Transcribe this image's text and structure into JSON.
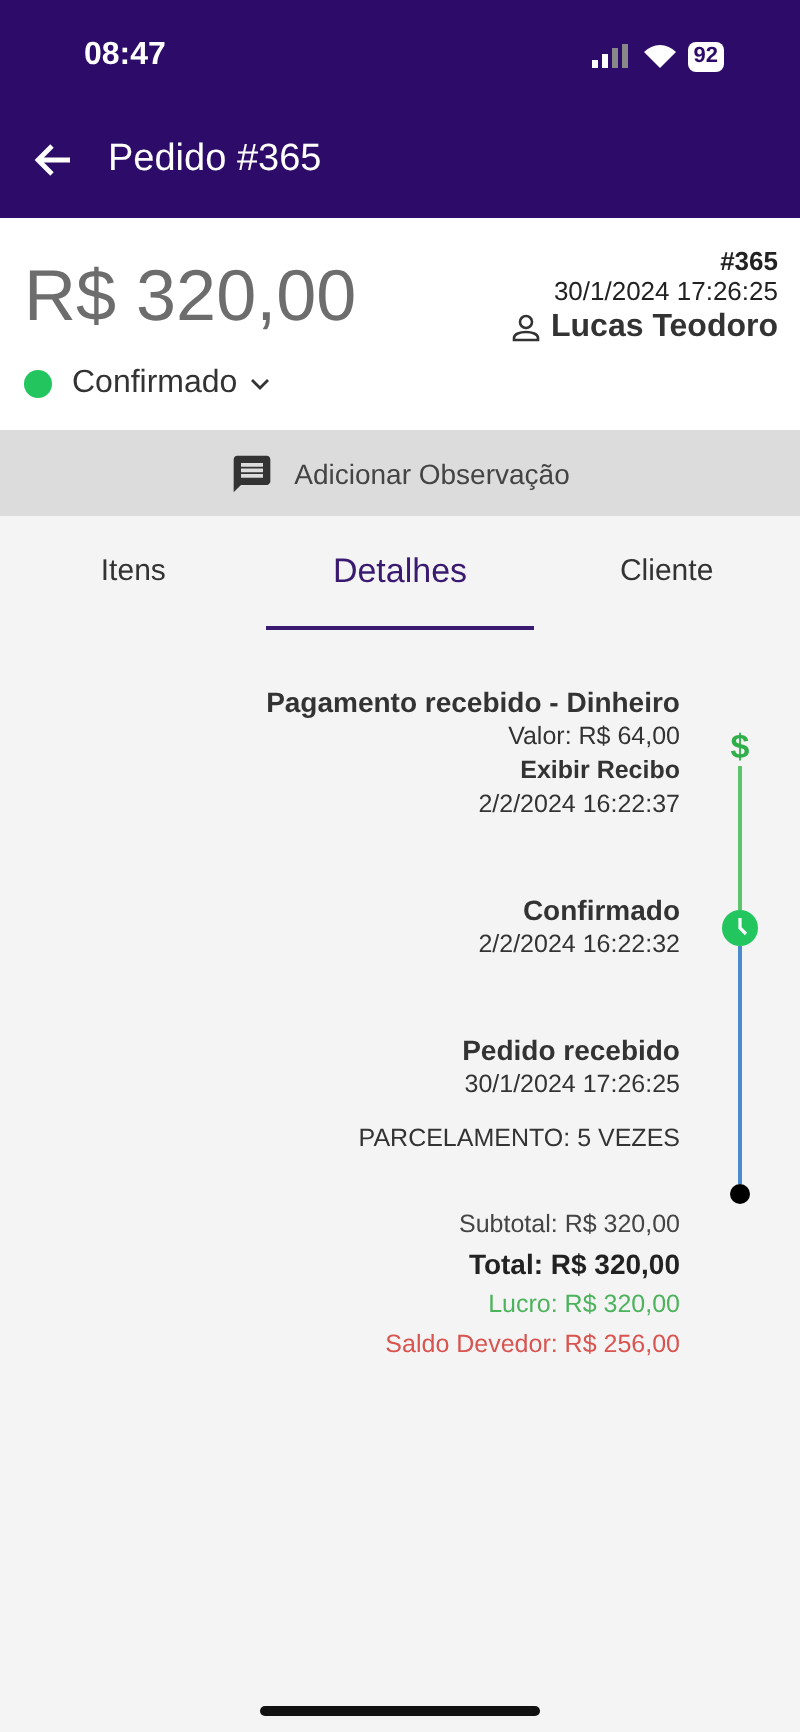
{
  "status_bar": {
    "time": "08:47",
    "battery": "92"
  },
  "app_bar": {
    "title": "Pedido #365"
  },
  "header": {
    "amount": "R$ 320,00",
    "order_number": "#365",
    "date": "30/1/2024 17:26:25",
    "customer": "Lucas Teodoro",
    "status": "Confirmado"
  },
  "note_button": {
    "label": "Adicionar Observação"
  },
  "tabs": [
    {
      "label": "Itens",
      "selected": false
    },
    {
      "label": "Detalhes",
      "selected": true
    },
    {
      "label": "Cliente",
      "selected": false
    }
  ],
  "timeline": [
    {
      "kind": "payment",
      "marker": "$",
      "title": "Pagamento recebido - Dinheiro",
      "value": "Valor: R$ 64,00",
      "link": "Exibir Recibo",
      "date": "2/2/2024 16:22:37"
    },
    {
      "kind": "status",
      "title": "Confirmado",
      "date": "2/2/2024 16:22:32"
    },
    {
      "kind": "order",
      "title": "Pedido recebido",
      "date": "30/1/2024 17:26:25",
      "installments": "PARCELAMENTO: 5 VEZES"
    }
  ],
  "totals": {
    "subtotal": "Subtotal: R$ 320,00",
    "total": "Total: R$ 320,00",
    "profit": "Lucro: R$ 320,00",
    "balance": "Saldo Devedor: R$ 256,00"
  }
}
